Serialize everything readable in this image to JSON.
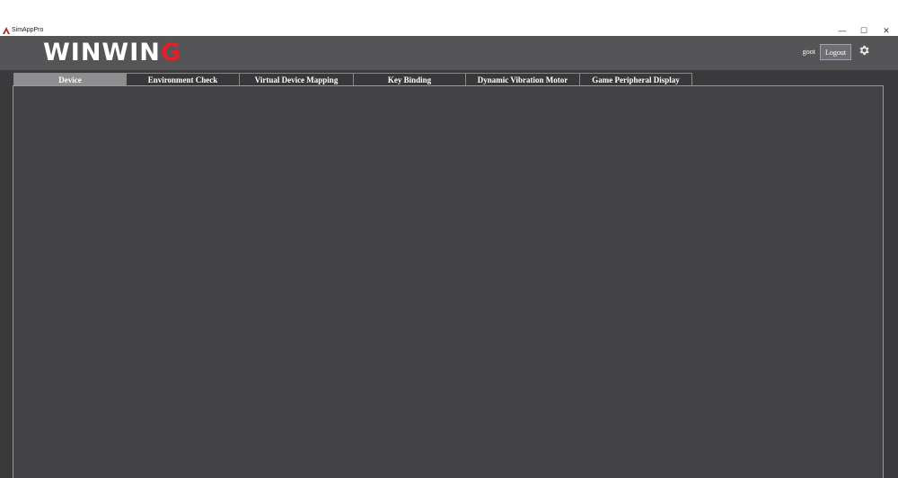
{
  "window": {
    "title": "SimAppPro",
    "minimize_glyph": "—",
    "maximize_glyph": "☐",
    "close_glyph": "✕"
  },
  "header": {
    "logo_main": "WINWIN",
    "logo_accent": "G",
    "username": "goot",
    "logout_label": "Logout",
    "settings_icon": "gear-icon"
  },
  "tabs": [
    {
      "label": "Device",
      "active": true
    },
    {
      "label": "Environment Check",
      "active": false
    },
    {
      "label": "Virtual Device Mapping",
      "active": false
    },
    {
      "label": "Key Binding",
      "active": false
    },
    {
      "label": "Dynamic Vibration Motor",
      "active": false
    },
    {
      "label": "Game Peripheral Display",
      "active": false
    }
  ],
  "colors": {
    "header_bg": "#555557",
    "content_bg": "#434345",
    "logo_accent": "#e0202a",
    "tab_active_bg": "#8e8e90"
  }
}
